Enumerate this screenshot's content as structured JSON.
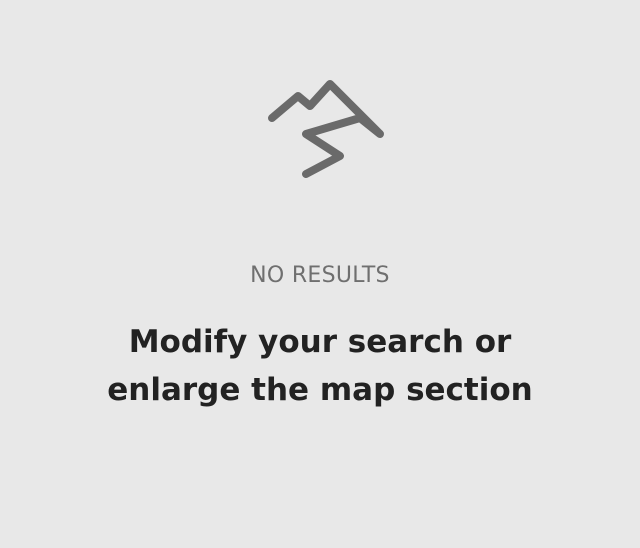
{
  "empty_state": {
    "icon": "mountain-icon",
    "status": "NO RESULTS",
    "message": "Modify your search or enlarge the map section"
  },
  "colors": {
    "background": "#e8e8e8",
    "icon": "#6a6a6a",
    "status_text": "#6f6f6f",
    "message_text": "#222222"
  }
}
